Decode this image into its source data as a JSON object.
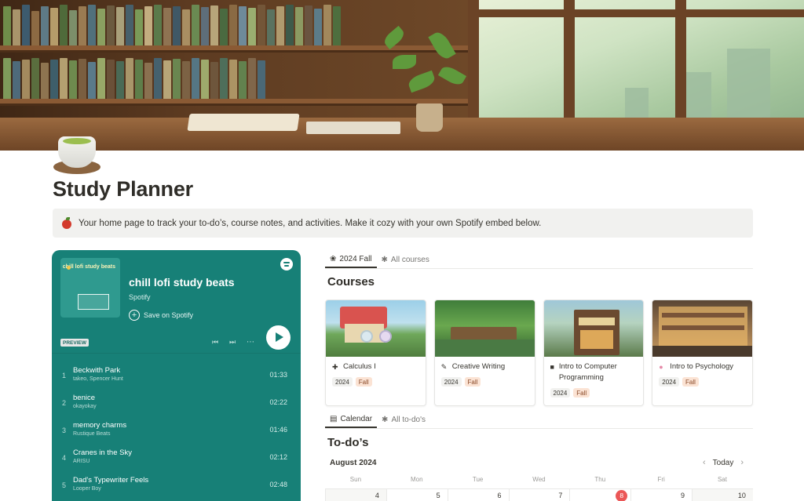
{
  "page": {
    "title": "Study Planner",
    "callout_text": "Your home page to track your to-do’s, course notes, and activities. Make it cozy with your own Spotify embed below."
  },
  "spotify": {
    "art_text": "chill lofi study beats",
    "playlist_title": "chill lofi study beats",
    "source": "Spotify",
    "save_label": "Save on Spotify",
    "preview_badge": "PREVIEW",
    "tracks": [
      {
        "num": "1",
        "name": "Beckwith Park",
        "artist": "takeo, Spencer Hunt",
        "duration": "01:33"
      },
      {
        "num": "2",
        "name": "benice",
        "artist": "okayokay",
        "duration": "02:22"
      },
      {
        "num": "3",
        "name": "memory charms",
        "artist": "Rustique Beats",
        "duration": "01:46"
      },
      {
        "num": "4",
        "name": "Cranes in the Sky",
        "artist": "ARISU",
        "duration": "02:12"
      },
      {
        "num": "5",
        "name": "Dad's Typewriter Feels",
        "artist": "Looper Boy",
        "duration": "02:48"
      }
    ]
  },
  "courses_view": {
    "tabs": [
      {
        "label": "2024 Fall",
        "icon": "leaf-icon",
        "active": true
      },
      {
        "label": "All courses",
        "icon": "asterisk-icon",
        "active": false
      }
    ],
    "heading": "Courses",
    "cards": [
      {
        "icon": "plus-icon",
        "title": "Calculus I",
        "year": "2024",
        "term": "Fall",
        "accent": "#c94a3a"
      },
      {
        "icon": "scroll-icon",
        "title": "Creative Writing",
        "year": "2024",
        "term": "Fall",
        "accent": "#3f7d3a"
      },
      {
        "icon": "laptop-icon",
        "title": "Intro to Computer Programming",
        "year": "2024",
        "term": "Fall",
        "accent": "#6b5a3f"
      },
      {
        "icon": "brain-icon",
        "title": "Intro to Psychology",
        "year": "2024",
        "term": "Fall",
        "accent": "#b5823f"
      }
    ]
  },
  "todo_view": {
    "tabs": [
      {
        "label": "Calendar",
        "icon": "calendar-icon",
        "active": true
      },
      {
        "label": "All to-do's",
        "icon": "asterisk-icon",
        "active": false
      }
    ],
    "heading": "To-do’s",
    "calendar": {
      "month": "August 2024",
      "today_label": "Today",
      "weekdays": [
        "Sun",
        "Mon",
        "Tue",
        "Wed",
        "Thu",
        "Fri",
        "Sat"
      ],
      "first_row": [
        "4",
        "5",
        "6",
        "7",
        "8",
        "9",
        "10"
      ],
      "today_date": "8"
    }
  },
  "colors": {
    "spotify_bg": "#178077",
    "tag_fall_bg": "#fbe3d4",
    "today_badge": "#eb5757"
  }
}
